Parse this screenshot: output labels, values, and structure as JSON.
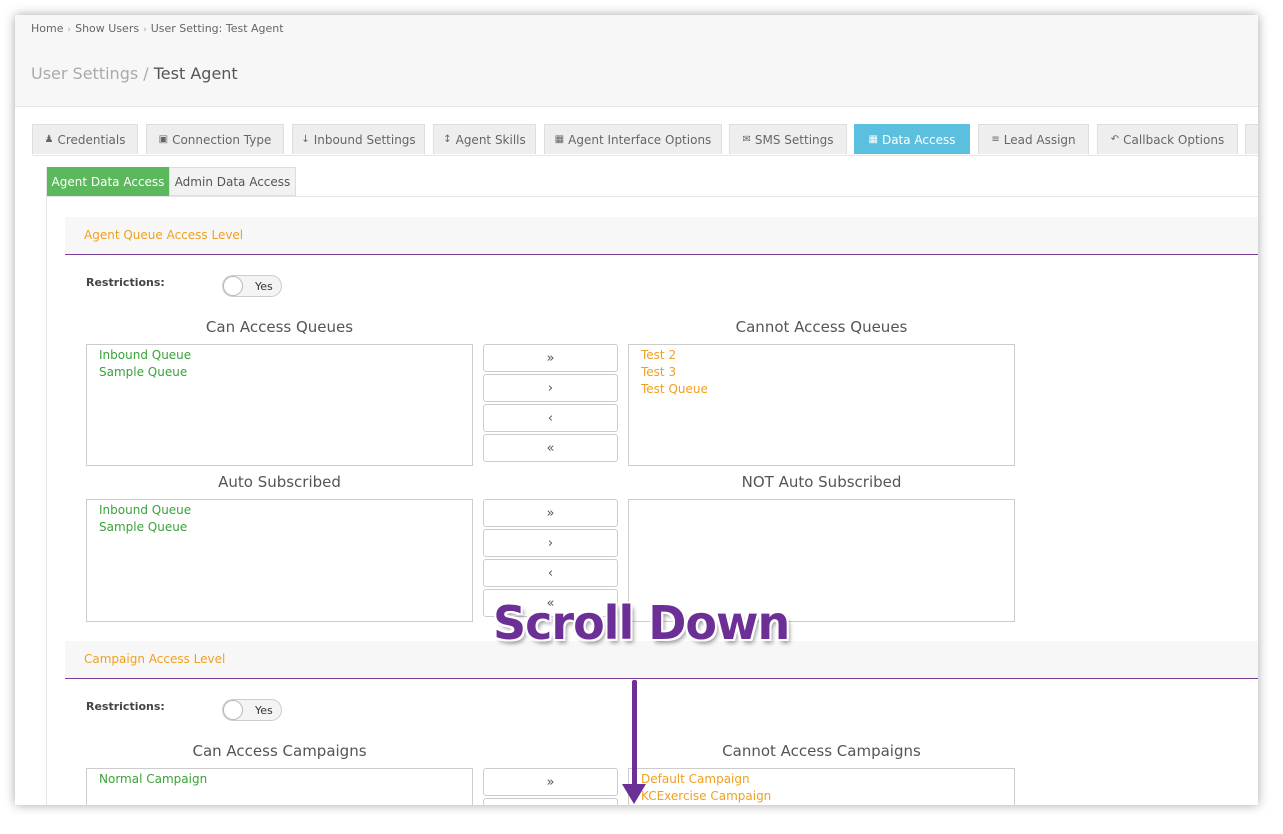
{
  "breadcrumb": {
    "items": [
      "Home",
      "Show Users",
      "User Setting: Test Agent"
    ]
  },
  "header": {
    "title_prefix": "User Settings / ",
    "title_current": "Test Agent"
  },
  "tabs": [
    {
      "label": "Credentials",
      "icon": "user-icon"
    },
    {
      "label": "Connection Type",
      "icon": "lock-icon"
    },
    {
      "label": "Inbound Settings",
      "icon": "arrow-down-icon"
    },
    {
      "label": "Agent Skills",
      "icon": "arrows-v-icon"
    },
    {
      "label": "Agent Interface Options",
      "icon": "grid-icon"
    },
    {
      "label": "SMS Settings",
      "icon": "envelope-icon"
    },
    {
      "label": "Data Access",
      "icon": "grid-icon",
      "active": true
    },
    {
      "label": "Lead Assign",
      "icon": "list-icon"
    },
    {
      "label": "Callback Options",
      "icon": "reply-icon"
    }
  ],
  "subtabs": [
    {
      "label": "Agent Data Access",
      "active": true
    },
    {
      "label": "Admin Data Access"
    }
  ],
  "queue_section": {
    "title": "Agent Queue Access Level",
    "restrictions_label": "Restrictions:",
    "toggle_label": "Yes",
    "can_access_title": "Can Access Queues",
    "cannot_access_title": "Cannot Access Queues",
    "can_access": [
      "Inbound Queue",
      "Sample Queue"
    ],
    "cannot_access": [
      "Test 2",
      "Test 3",
      "Test Queue"
    ],
    "auto_title": "Auto Subscribed",
    "not_auto_title": "NOT Auto Subscribed",
    "auto": [
      "Inbound Queue",
      "Sample Queue"
    ],
    "not_auto": []
  },
  "campaign_section": {
    "title": "Campaign Access Level",
    "restrictions_label": "Restrictions:",
    "toggle_label": "Yes",
    "can_access_title": "Can Access Campaigns",
    "cannot_access_title": "Cannot Access Campaigns",
    "can_access": [
      "Normal Campaign"
    ],
    "cannot_access": [
      "Default Campaign",
      "KCExercise Campaign"
    ]
  },
  "move_buttons": {
    "all_right": "»",
    "right": "›",
    "left": "‹",
    "all_left": "«"
  },
  "overlay": {
    "text": "Scroll Down"
  },
  "colors": {
    "active_tab": "#5bc0de",
    "active_subtab": "#5cb85c",
    "section_title": "#f0a020",
    "overlay": "#6b2f95"
  }
}
